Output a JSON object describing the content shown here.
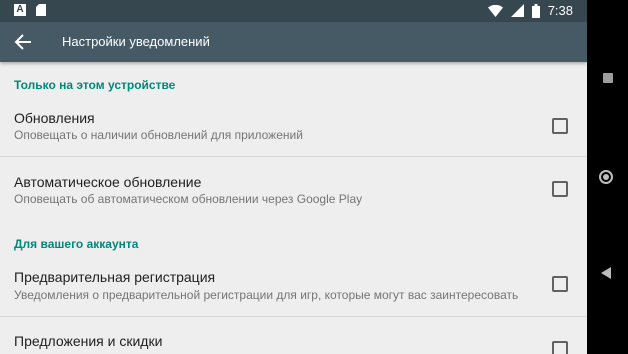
{
  "status_bar": {
    "time": "7:38",
    "left_icons": [
      "a-notification-icon",
      "sd-card-icon"
    ],
    "a_glyph": "A",
    "right_icons": [
      "wifi-icon",
      "signal-icon",
      "battery-icon"
    ]
  },
  "toolbar": {
    "back_icon": "arrow-back-icon",
    "title": "Настройки уведомлений"
  },
  "sections": [
    {
      "header": "Только на этом устройстве",
      "items": [
        {
          "title": "Обновления",
          "subtitle": "Оповещать о наличии обновлений для приложений",
          "checked": false
        },
        {
          "title": "Автоматическое обновление",
          "subtitle": "Оповещать об автоматическом обновлении через Google Play",
          "checked": false
        }
      ]
    },
    {
      "header": "Для вашего аккаунта",
      "items": [
        {
          "title": "Предварительная регистрация",
          "subtitle": "Уведомления о предварительной регистрации для игр, которые могут вас заинтересовать",
          "checked": false
        },
        {
          "title": "Предложения и скидки",
          "subtitle": "",
          "checked": false
        }
      ]
    }
  ],
  "nav_bar": {
    "icons": [
      "recents-square-icon",
      "home-circle-icon",
      "back-triangle-icon"
    ]
  },
  "colors": {
    "status_bar": "#37474f",
    "toolbar": "#455a64",
    "section_header": "#00897b",
    "background": "#eeeeee"
  }
}
